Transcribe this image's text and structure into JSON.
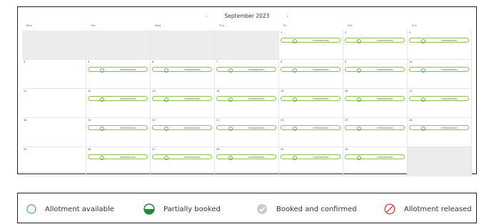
{
  "calendar": {
    "month_title": "September 2023",
    "prev_arrow": "‹",
    "next_arrow": "›",
    "days_of_week": [
      "Mon",
      "Tue",
      "Wed",
      "Thu",
      "Fri",
      "Sat",
      "Sun"
    ],
    "booking_code": "SYDSNQF0001",
    "weeks": [
      [
        null,
        null,
        null,
        null,
        "1",
        "2",
        "3"
      ],
      [
        "4",
        "5",
        "6",
        "7",
        "8",
        "9",
        "10"
      ],
      [
        "11",
        "12",
        "13",
        "14",
        "15",
        "16",
        "17"
      ],
      [
        "18",
        "19",
        "20",
        "21",
        "22",
        "23",
        "24"
      ],
      [
        "25",
        "26",
        "27",
        "28",
        "29",
        "30",
        null
      ]
    ],
    "available_days": [
      "1",
      "2",
      "3",
      "5",
      "6",
      "7",
      "8",
      "9",
      "10",
      "12",
      "13",
      "14",
      "15",
      "16",
      "17",
      "19",
      "20",
      "21",
      "22",
      "23",
      "24",
      "26",
      "27",
      "28",
      "29",
      "30"
    ]
  },
  "legend": {
    "items": [
      {
        "label": "Allotment available",
        "icon": "available-icon"
      },
      {
        "label": "Partially booked",
        "icon": "partial-icon"
      },
      {
        "label": "Booked and confirmed",
        "icon": "confirmed-icon"
      },
      {
        "label": "Allotment released",
        "icon": "released-icon"
      }
    ]
  }
}
